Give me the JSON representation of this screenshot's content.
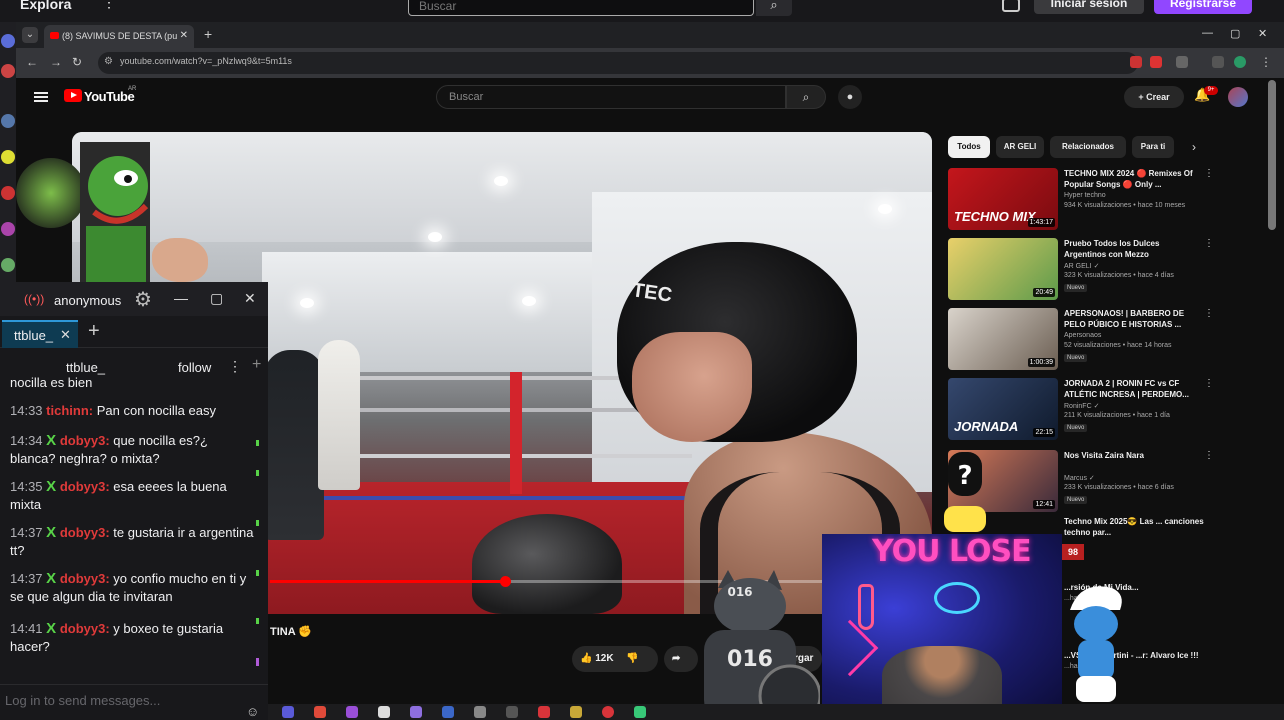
{
  "twitch": {
    "explore": "Explora",
    "search_placeholder": "Buscar",
    "login": "Iniciar sesión",
    "signup": "Registrarse"
  },
  "chrome": {
    "tab_title": "(8) SAVIMUS DE DESTA (pu",
    "url": "youtube.com/watch?v=_pNzlwq9&t=5m11s"
  },
  "youtube": {
    "logo_text": "YouTube",
    "country": "AR",
    "search_placeholder": "Buscar",
    "create": "Crear",
    "notif_count": "9+",
    "video_title_fragment": "TINA",
    "likes": "12K",
    "share_fragment": "rgar",
    "progress_fraction": 0.42,
    "chips": [
      {
        "label": "Todos",
        "active": true
      },
      {
        "label": "AR GELI",
        "active": false
      },
      {
        "label": "Relacionados",
        "active": false
      },
      {
        "label": "Para ti",
        "active": false
      }
    ],
    "recommendations": [
      {
        "title": "TECHNO MIX 2024 🔴 Remixes Of Popular Songs 🔴 Only ...",
        "channel": "Hyper techno",
        "meta": "934 K visualizaciones • hace 10 meses",
        "duration": "1:43:17",
        "thumb_text": "TECHNO MIX",
        "nuevo": ""
      },
      {
        "title": "Pruebo Todos los Dulces Argentinos con Mezzo",
        "channel": "AR GELI ✓",
        "meta": "323 K visualizaciones • hace 4 días",
        "duration": "20:49",
        "thumb_text": "",
        "nuevo": "Nuevo"
      },
      {
        "title": "APERSONAOS! | BARBERO DE PELO PÚBICO E HISTORIAS ...",
        "channel": "Apersonaos",
        "meta": "52 visualizaciones • hace 14 horas",
        "duration": "1:00:39",
        "thumb_text": "",
        "nuevo": "Nuevo"
      },
      {
        "title": "JORNADA 2 | RONIN FC vs CF ATLÉTIC INCRESA | PERDEMO...",
        "channel": "RoninFC ✓",
        "meta": "211 K visualizaciones • hace 1 día",
        "duration": "22:15",
        "thumb_text": "JORNADA",
        "nuevo": "Nuevo"
      },
      {
        "title": "Nos Visita Zaira Nara",
        "channel": "Marcus ✓",
        "meta": "233 K visualizaciones • hace 6 días",
        "duration": "12:41",
        "thumb_text": "",
        "nuevo": "Nuevo"
      },
      {
        "title": "Techno Mix 2025😎 Las ... canciones techno par...",
        "channel": "",
        "meta": "",
        "duration": "",
        "thumb_text": "",
        "nuevo": ""
      },
      {
        "title": "...rsión de Mi Vida...",
        "channel": "",
        "meta": "...hace 5 días",
        "duration": "",
        "thumb_text": "",
        "nuevo": ""
      },
      {
        "title": "...VS Alex Martini - ...r: Alvaro Ice !!!",
        "channel": "",
        "meta": "...hace 1 año",
        "duration": "",
        "thumb_text": "",
        "nuevo": ""
      }
    ]
  },
  "chat": {
    "app_title": "anonymous",
    "tab_label": "ttblue_",
    "channel_user": "ttblue_",
    "follow_label": "follow",
    "input_placeholder": "Log in to send messages...",
    "messages": [
      {
        "time": "",
        "nick": "",
        "text": "nocilla es bien",
        "badge": false
      },
      {
        "time": "14:33",
        "nick": "tichinn:",
        "text": "Pan con nocilla easy",
        "badge": false
      },
      {
        "time": "14:34",
        "nick": "dobyy3:",
        "text": "que nocilla es?¿ blanca? neghra? o mixta?",
        "badge": true
      },
      {
        "time": "14:35",
        "nick": "dobyy3:",
        "text": "esa eeees la buena mixta",
        "badge": true
      },
      {
        "time": "14:37",
        "nick": "dobyy3:",
        "text": "te gustaria ir a argentina tt?",
        "badge": true
      },
      {
        "time": "14:37",
        "nick": "dobyy3:",
        "text": "yo confio mucho en ti y se que algun dia te invitaran",
        "badge": true
      },
      {
        "time": "14:41",
        "nick": "dobyy3:",
        "text": "y boxeo te gustaria hacer?",
        "badge": true
      }
    ],
    "badge_glyph": "X"
  },
  "overlay": {
    "you_lose": "YOU LOSE",
    "kill_count": "98",
    "cat_number": "016"
  },
  "video": {
    "helmet_brand": "TEC"
  },
  "colors": {
    "twitch_purple": "#9147ff",
    "yt_red": "#ff0000",
    "chat_nick": "#e03a3a",
    "badge_green": "#58d348"
  }
}
